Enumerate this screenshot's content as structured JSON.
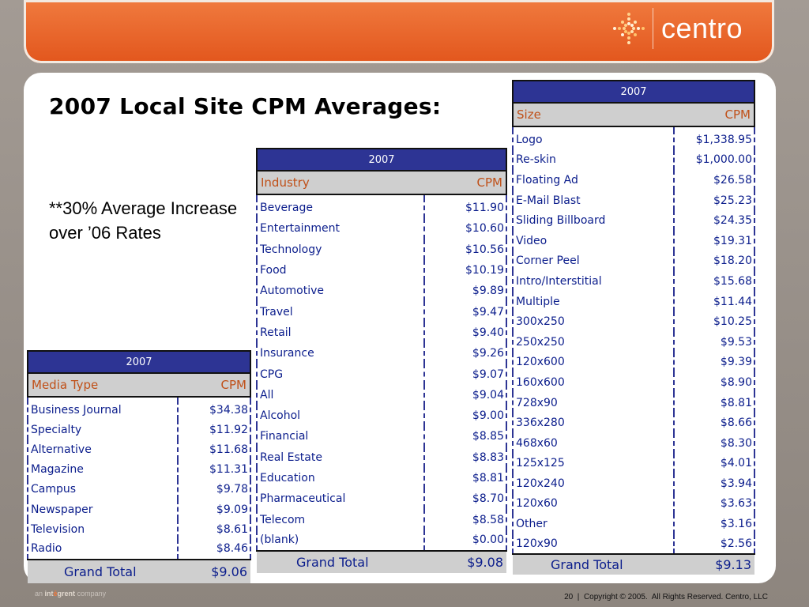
{
  "colors": {
    "header_orange": "#e2561d",
    "table_header_blue": "#2d3494",
    "column_header_text": "#c05018",
    "cell_text": "#0b1d8c",
    "total_bg": "#cfcfcf"
  },
  "header": {
    "logo_text": "centro"
  },
  "slide": {
    "title": "2007 Local Site CPM Averages:",
    "note": "**30% Average Increase over ’06 Rates"
  },
  "media_table": {
    "year": "2007",
    "col_label": "Media Type",
    "col_value": "CPM",
    "rows": [
      {
        "label": "Business Journal",
        "value": "$34.38"
      },
      {
        "label": "Specialty",
        "value": "$11.92"
      },
      {
        "label": "Alternative",
        "value": "$11.68"
      },
      {
        "label": "Magazine",
        "value": "$11.31"
      },
      {
        "label": "Campus",
        "value": "$9.78"
      },
      {
        "label": "Newspaper",
        "value": "$9.09"
      },
      {
        "label": "Television",
        "value": "$8.61"
      },
      {
        "label": "Radio",
        "value": "$8.46"
      }
    ],
    "total_label": "Grand Total",
    "total_value": "$9.06"
  },
  "industry_table": {
    "year": "2007",
    "col_label": "Industry",
    "col_value": "CPM",
    "rows": [
      {
        "label": "Beverage",
        "value": "$11.90"
      },
      {
        "label": "Entertainment",
        "value": "$10.60"
      },
      {
        "label": "Technology",
        "value": "$10.56"
      },
      {
        "label": "Food",
        "value": "$10.19"
      },
      {
        "label": "Automotive",
        "value": "$9.89"
      },
      {
        "label": "Travel",
        "value": "$9.47"
      },
      {
        "label": "Retail",
        "value": "$9.40"
      },
      {
        "label": "Insurance",
        "value": "$9.26"
      },
      {
        "label": "CPG",
        "value": "$9.07"
      },
      {
        "label": "All",
        "value": "$9.04"
      },
      {
        "label": "Alcohol",
        "value": "$9.00"
      },
      {
        "label": "Financial",
        "value": "$8.85"
      },
      {
        "label": "Real Estate",
        "value": "$8.83"
      },
      {
        "label": "Education",
        "value": "$8.81"
      },
      {
        "label": "Pharmaceutical",
        "value": "$8.70"
      },
      {
        "label": "Telecom",
        "value": "$8.58"
      },
      {
        "label": "(blank)",
        "value": "$0.00"
      }
    ],
    "total_label": "Grand Total",
    "total_value": "$9.08"
  },
  "size_table": {
    "year": "2007",
    "col_label": "Size",
    "col_value": "CPM",
    "rows": [
      {
        "label": "Logo",
        "value": "$1,338.95"
      },
      {
        "label": "Re-skin",
        "value": "$1,000.00"
      },
      {
        "label": "Floating Ad",
        "value": "$26.58"
      },
      {
        "label": "E-Mail Blast",
        "value": "$25.23"
      },
      {
        "label": "Sliding Billboard",
        "value": "$24.35"
      },
      {
        "label": "Video",
        "value": "$19.31"
      },
      {
        "label": "Corner Peel",
        "value": "$18.20"
      },
      {
        "label": "Intro/Interstitial",
        "value": "$15.68"
      },
      {
        "label": "Multiple",
        "value": "$11.44"
      },
      {
        "label": "300x250",
        "value": "$10.25"
      },
      {
        "label": "250x250",
        "value": "$9.53"
      },
      {
        "label": "120x600",
        "value": "$9.39"
      },
      {
        "label": "160x600",
        "value": "$8.90"
      },
      {
        "label": "728x90",
        "value": "$8.81"
      },
      {
        "label": "336x280",
        "value": "$8.66"
      },
      {
        "label": "468x60",
        "value": "$8.30"
      },
      {
        "label": "125x125",
        "value": "$4.01"
      },
      {
        "label": "120x240",
        "value": "$3.94"
      },
      {
        "label": "120x60",
        "value": "$3.63"
      },
      {
        "label": "Other",
        "value": "$3.16"
      },
      {
        "label": "120x90",
        "value": "$2.56"
      }
    ],
    "total_label": "Grand Total",
    "total_value": "$9.13"
  },
  "footer": {
    "brand_prefix": "an",
    "brand_name_pre": "int",
    "brand_name_accent": "ē",
    "brand_name_post": "grent",
    "brand_suffix": "company",
    "copyright": "20  |  Copyright © 2005.  All Rights Reserved. Centro, LLC"
  }
}
